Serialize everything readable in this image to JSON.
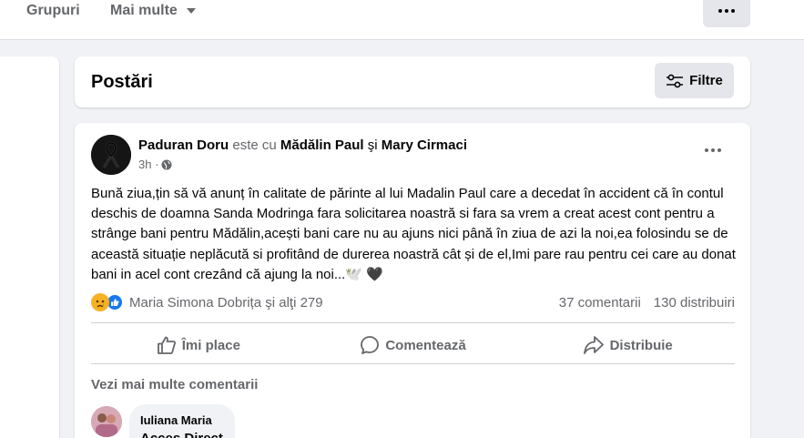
{
  "topnav": {
    "groups_label": "Grupuri",
    "more_label": "Mai multe"
  },
  "posts_section": {
    "title": "Postări",
    "filter_label": "Filtre"
  },
  "post": {
    "author": "Paduran Doru",
    "with_text": "este cu",
    "tagged_1": "Mădălin Paul",
    "and_text": "şi",
    "tagged_2": "Mary Cirmaci",
    "time": "3h ·",
    "body": "Bună ziua,țin să vă anunț în calitate de părinte al lui Madalin Paul care a decedat în accident că în contul deschis de doamna Sanda Modringa fara solicitarea noastră si fara sa vrem a creat acest cont pentru a strânge bani pentru Mădălin,acești bani care nu au ajuns nici până în ziua de azi la noi,ea folosindu se de această situație neplăcută si profitând de durerea noastră cât și de el,Imi pare rau pentru cei care au donat bani in acel cont crezând că ajung la noi...🕊️ 🖤",
    "reactions_text": "Maria Simona Dobrița şi alţi 279",
    "comments_count": "37 comentarii",
    "shares_count": "130 distribuiri",
    "like_label": "Îmi place",
    "comment_label": "Comentează",
    "share_label": "Distribuie",
    "more_comments_label": "Vezi mai multe comentarii"
  },
  "comment": {
    "name": "Iuliana Maria",
    "text": "Acces Direct"
  },
  "colors": {
    "background": "#f0f2f5",
    "card": "#ffffff",
    "secondary_text": "#65676b",
    "like_blue": "#1877f2",
    "sad_yellow": "#f7b125"
  }
}
